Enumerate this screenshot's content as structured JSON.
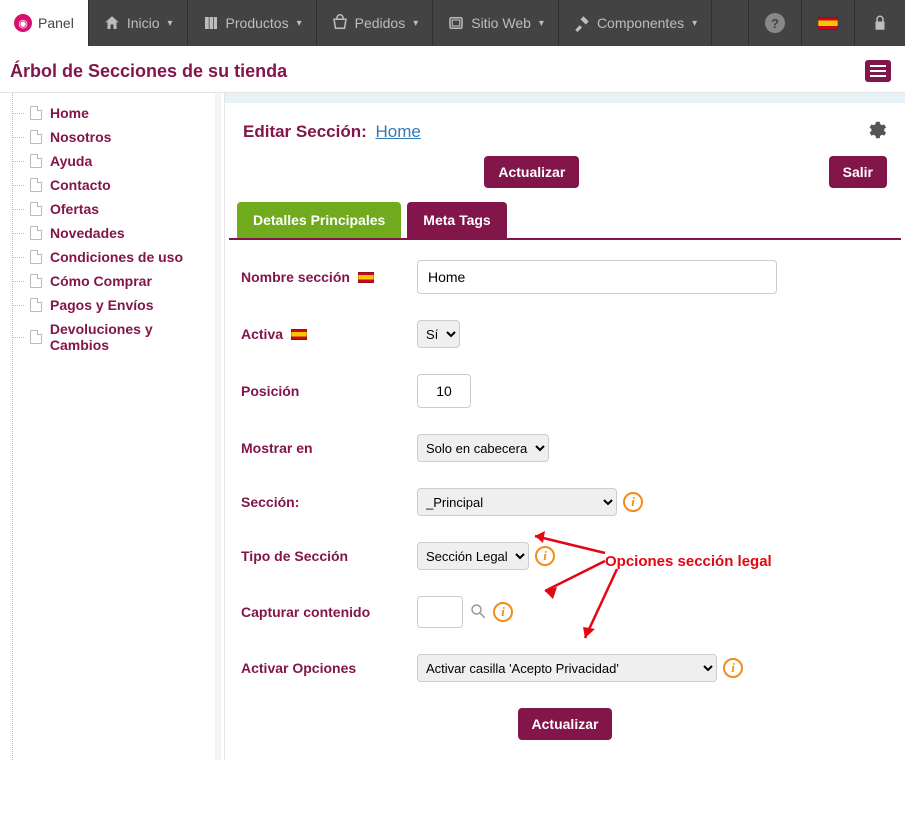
{
  "nav": {
    "panel": "Panel",
    "inicio": "Inicio",
    "productos": "Productos",
    "pedidos": "Pedidos",
    "sitio": "Sitio Web",
    "componentes": "Componentes"
  },
  "page_title": "Árbol de Secciones de su tienda",
  "tree": {
    "items": [
      "Home",
      "Nosotros",
      "Ayuda",
      "Contacto",
      "Ofertas",
      "Novedades",
      "Condiciones de uso",
      "Cómo Comprar",
      "Pagos y Envíos",
      "Devoluciones y Cambios"
    ]
  },
  "editor": {
    "title_prefix": "Editar Sección:",
    "title_link": "Home",
    "actualizar": "Actualizar",
    "salir": "Salir",
    "tabs": {
      "detalles": "Detalles Principales",
      "meta": "Meta Tags"
    },
    "fields": {
      "nombre_label": "Nombre sección",
      "nombre_value": "Home",
      "activa_label": "Activa",
      "activa_value": "Sí",
      "posicion_label": "Posición",
      "posicion_value": "10",
      "mostrar_label": "Mostrar en",
      "mostrar_value": "Solo en cabecera",
      "seccion_label": "Sección:",
      "seccion_value": "_Principal",
      "tipo_label": "Tipo de Sección",
      "tipo_value": "Sección Legal",
      "capturar_label": "Capturar contenido",
      "activar_label": "Activar Opciones",
      "activar_value": "Activar casilla 'Acepto Privacidad'"
    }
  },
  "annotation": "Opciones sección legal"
}
